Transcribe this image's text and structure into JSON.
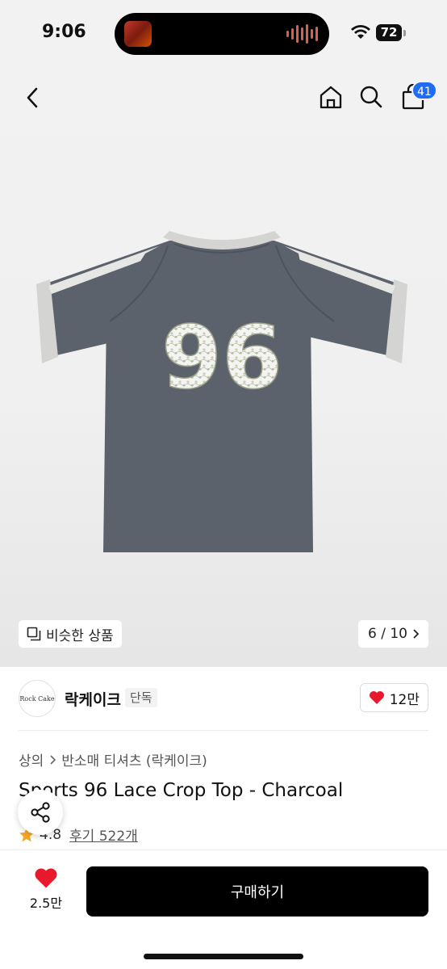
{
  "status": {
    "time": "9:06",
    "battery": "72"
  },
  "nav": {
    "cart_count": "41"
  },
  "image": {
    "shirt_number": "96",
    "similar_label": "비슷한 상품",
    "counter": "6 / 10"
  },
  "brand": {
    "logo_text": "Rock Cake",
    "name": "락케이크",
    "tag": "단독",
    "likes": "12만"
  },
  "breadcrumb": {
    "level1": "상의",
    "level2": "반소매 티셔츠 (락케이크)"
  },
  "product": {
    "title": "Sports 96 Lace Crop Top - Charcoal",
    "rating": "4.8",
    "reviews": "후기 522개"
  },
  "bottom": {
    "wish_count": "2.5만",
    "buy_label": "구매하기"
  },
  "colors": {
    "accent_blue": "#1f6cf0",
    "heart_red": "#e8192c",
    "star": "#f5a623",
    "shirt_body": "#5b626c",
    "shirt_trim": "#d4d4d2"
  }
}
